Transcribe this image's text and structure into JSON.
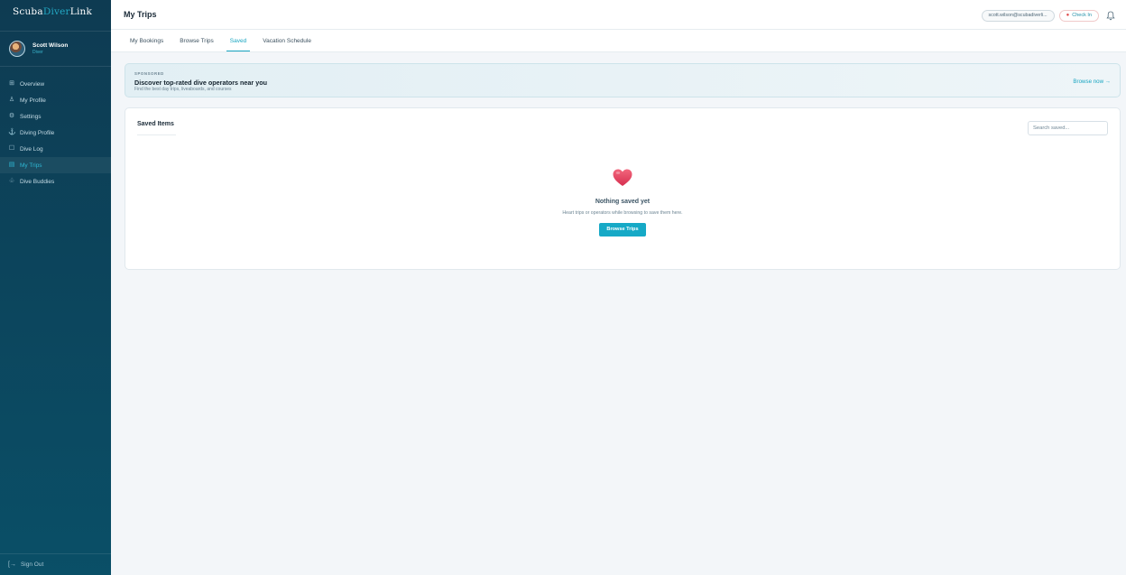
{
  "brand": {
    "part1": "Scuba",
    "part2": "Diver",
    "part3": "Link"
  },
  "user": {
    "name": "Scott Wilson",
    "role": "Diver"
  },
  "sidebar": {
    "items": [
      {
        "label": "Overview",
        "icon": "grid-icon",
        "glyph": "⊞",
        "active": false
      },
      {
        "label": "My Profile",
        "icon": "user-icon",
        "glyph": "♙",
        "active": false
      },
      {
        "label": "Settings",
        "icon": "gear-icon",
        "glyph": "⚙",
        "active": false
      },
      {
        "label": "Diving Profile",
        "icon": "anchor-icon",
        "glyph": "⚓",
        "active": false
      },
      {
        "label": "Dive Log",
        "icon": "log-icon",
        "glyph": "☐",
        "active": false
      },
      {
        "label": "My Trips",
        "icon": "calendar-icon",
        "glyph": "▤",
        "active": true
      },
      {
        "label": "Dive Buddies",
        "icon": "users-icon",
        "glyph": "♧",
        "active": false
      }
    ],
    "sign_out": "Sign Out",
    "sign_out_icon": "sign-out-icon"
  },
  "header": {
    "title": "My Trips",
    "email": "scott.wilson@scubadiverli...",
    "check_in": "Check In",
    "bell_icon": "bell-icon"
  },
  "tabs": [
    {
      "label": "My Bookings",
      "active": false
    },
    {
      "label": "Browse Trips",
      "active": false
    },
    {
      "label": "Saved",
      "active": true
    },
    {
      "label": "Vacation Schedule",
      "active": false
    }
  ],
  "banner": {
    "tag": "SPONSORED",
    "title": "Discover top-rated dive operators near you",
    "subtitle": "Find the best day trips, liveaboards, and courses",
    "cta": "Browse now →"
  },
  "saved": {
    "title": "Saved Items",
    "search_placeholder": "Search saved...",
    "empty_title": "Nothing saved yet",
    "empty_subtitle": "Heart trips or operators while browsing to save them here.",
    "button": "Browse Trips"
  },
  "colors": {
    "accent": "#16a9c6",
    "sidebar": "#0e3b52",
    "heart": "#e8415f"
  }
}
